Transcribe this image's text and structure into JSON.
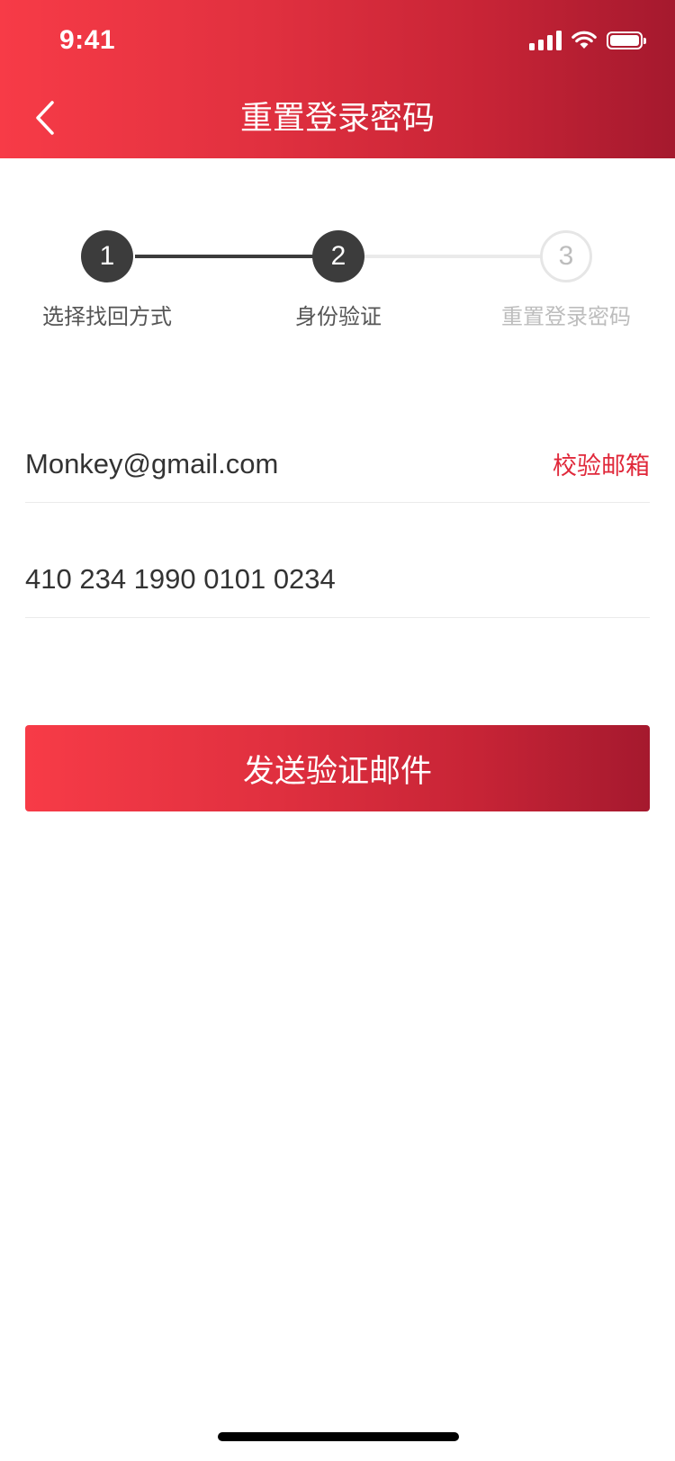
{
  "status_bar": {
    "time": "9:41",
    "icons": [
      "signal-icon",
      "wifi-icon",
      "battery-icon"
    ]
  },
  "nav": {
    "back_icon": "chevron-left-icon",
    "title": "重置登录密码"
  },
  "steps": [
    {
      "number": "1",
      "label": "选择找回方式",
      "state": "done"
    },
    {
      "number": "2",
      "label": "身份验证",
      "state": "current"
    },
    {
      "number": "3",
      "label": "重置登录密码",
      "state": "pending"
    }
  ],
  "form": {
    "email": {
      "value": "Monkey@gmail.com",
      "action_label": "校验邮箱"
    },
    "id_number": {
      "value": "410 234 1990 0101 0234"
    }
  },
  "submit": {
    "label": "发送验证邮件"
  },
  "colors": {
    "brand_start": "#F73B47",
    "brand_end": "#A5192E",
    "accent_text": "#E0283A",
    "step_active": "#3C3C3C",
    "step_inactive": "#BDBDBD"
  }
}
